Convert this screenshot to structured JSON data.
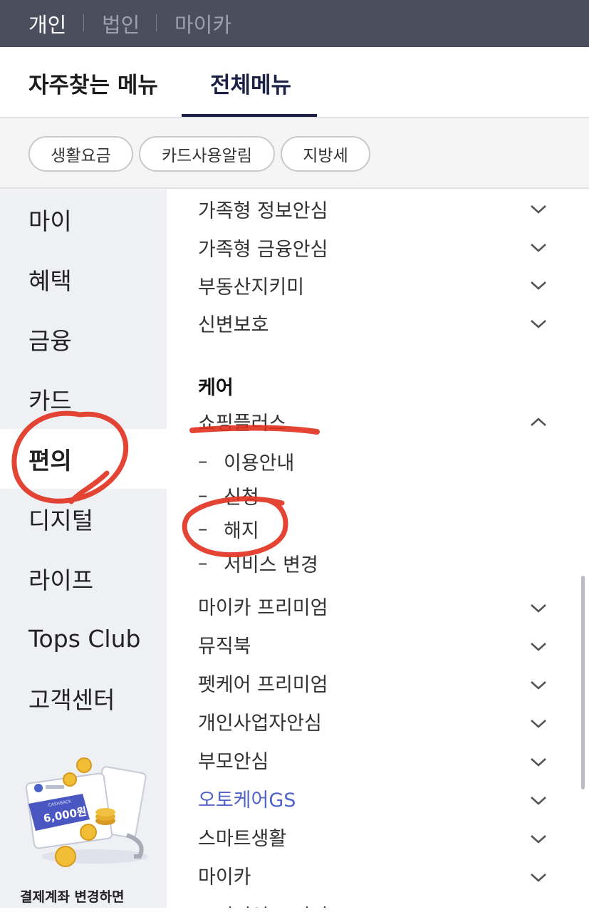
{
  "top_nav": {
    "personal": "개인",
    "corporate": "법인",
    "mycar": "마이카"
  },
  "tabs": {
    "favorites": "자주찾는 메뉴",
    "all_menu": "전체메뉴"
  },
  "chips": [
    "생활요금",
    "카드사용알림",
    "지방세"
  ],
  "categories": [
    "마이",
    "혜택",
    "금융",
    "카드",
    "편의",
    "디지털",
    "라이프",
    "Tops Club",
    "고객센터"
  ],
  "active_category": "편의",
  "promo": {
    "card_label": "CASHBACK",
    "amount": "6,000원",
    "caption": "결제계좌 변경하면"
  },
  "menu_top": [
    "가족형 정보안심",
    "가족형 금융안심",
    "부동산지키미",
    "신변보호"
  ],
  "section_title": "케어",
  "expanded_item": "쇼핑플러스",
  "sub_items": [
    "이용안내",
    "신청",
    "해지",
    "서비스 변경"
  ],
  "menu_bottom": [
    "마이카 프리미엄",
    "뮤직북",
    "펫케어 프리미엄",
    "개인사업자안심",
    "부모안심",
    "오토케어GS",
    "스마트생활",
    "마이카",
    "프리미엄 스피어+"
  ],
  "colors": {
    "topbar": "#4a4e5d",
    "accent": "#1b2044",
    "link": "#4f63c9",
    "annotation": "#e0301e"
  }
}
